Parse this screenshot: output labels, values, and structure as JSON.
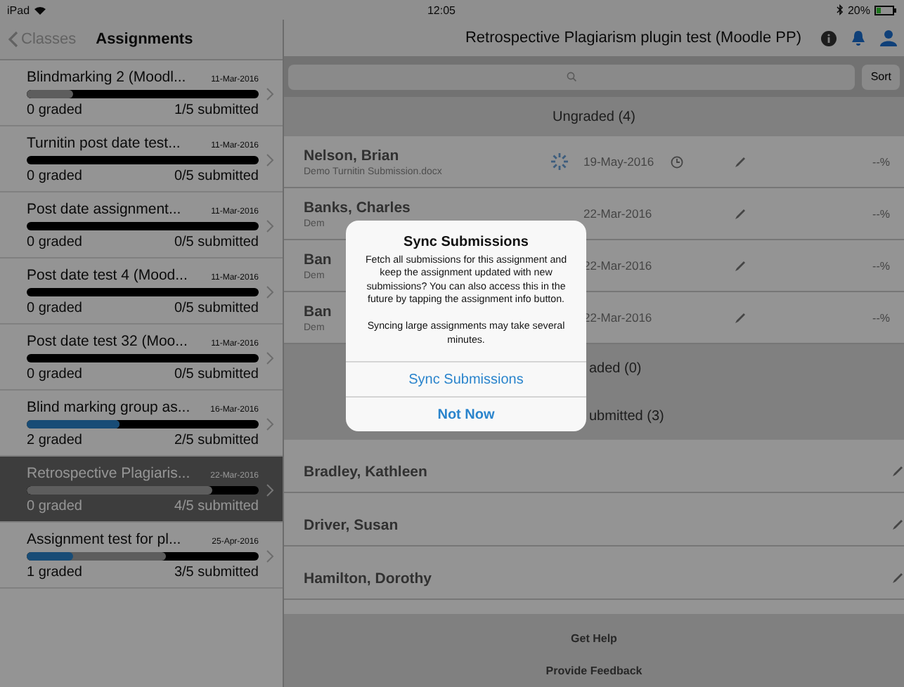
{
  "status_bar": {
    "device": "iPad",
    "time": "12:05",
    "battery": "20%"
  },
  "sidebar": {
    "back": "Classes",
    "title": "Assignments",
    "items": [
      {
        "title": "Blindmarking 2 (Moodl...",
        "date": "11-Mar-2016",
        "graded_bar": {
          "level": 0
        },
        "submitted_bar": {
          "level": 0.2
        },
        "graded": "0 graded",
        "submitted": "1/5 submitted",
        "selected": false
      },
      {
        "title": "Turnitin post date test...",
        "date": "11-Mar-2016",
        "graded_bar": {
          "level": 0
        },
        "submitted_bar": {
          "level": 0
        },
        "graded": "0 graded",
        "submitted": "0/5 submitted",
        "selected": false
      },
      {
        "title": "Post date assignment...",
        "date": "11-Mar-2016",
        "graded_bar": {
          "level": 0
        },
        "submitted_bar": {
          "level": 0
        },
        "graded": "0 graded",
        "submitted": "0/5 submitted",
        "selected": false
      },
      {
        "title": "Post date test 4 (Mood...",
        "date": "11-Mar-2016",
        "graded_bar": {
          "level": 0
        },
        "submitted_bar": {
          "level": 0
        },
        "graded": "0 graded",
        "submitted": "0/5 submitted",
        "selected": false
      },
      {
        "title": "Post date test 32 (Moo...",
        "date": "11-Mar-2016",
        "graded_bar": {
          "level": 0
        },
        "submitted_bar": {
          "level": 0
        },
        "graded": "0 graded",
        "submitted": "0/5 submitted",
        "selected": false
      },
      {
        "title": "Blind marking group as...",
        "date": "16-Mar-2016",
        "graded_bar": {
          "level": 0.4
        },
        "submitted_bar": {
          "level": 0.4
        },
        "graded": "2 graded",
        "submitted": "2/5 submitted",
        "selected": false
      },
      {
        "title": "Retrospective Plagiaris...",
        "date": "22-Mar-2016",
        "graded_bar": {
          "level": 0
        },
        "submitted_bar": {
          "level": 0.8
        },
        "graded": "0 graded",
        "submitted": "4/5 submitted",
        "selected": true
      },
      {
        "title": "Assignment test for pl...",
        "date": "25-Apr-2016",
        "graded_bar": {
          "level": 0.2
        },
        "submitted_bar": {
          "level": 0.6
        },
        "graded": "1 graded",
        "submitted": "3/5 submitted",
        "selected": false
      }
    ]
  },
  "main": {
    "title": "Retrospective Plagiarism plugin test (Moodle PP)",
    "sort": "Sort",
    "sections": [
      {
        "header": "Ungraded (4)",
        "kind": "full",
        "rows": [
          {
            "name": "Nelson, Brian",
            "file": "Demo Turnitin Submission.docx",
            "syncing": true,
            "date": "19-May-2016",
            "late": true,
            "grade": "--%"
          },
          {
            "name": "Banks, Charles",
            "file": "Dem",
            "syncing": false,
            "date": "22-Mar-2016",
            "late": false,
            "grade": "--%"
          },
          {
            "name": "Ban",
            "file": "Dem",
            "syncing": false,
            "date": "22-Mar-2016",
            "late": false,
            "grade": "--%"
          },
          {
            "name": "Ban",
            "file": "Dem",
            "syncing": false,
            "date": "22-Mar-2016",
            "late": false,
            "grade": "--%"
          }
        ]
      },
      {
        "header": "aded (0)",
        "kind": "covered"
      },
      {
        "header": "ubmitted (3)",
        "kind": "covered",
        "rows": [
          {
            "name": "Bradley, Kathleen"
          },
          {
            "name": "Driver, Susan"
          },
          {
            "name": "Hamilton, Dorothy"
          }
        ]
      }
    ],
    "footer": [
      "Get Help",
      "Provide Feedback"
    ]
  },
  "dialog": {
    "title": "Sync Submissions",
    "message": "Fetch all submissions for this assignment and keep the assignment updated with new submissions? You can also access this in the future by tapping the assignment info button.",
    "note": "Syncing large assignments may take several minutes.",
    "buttons": [
      {
        "label": "Sync Submissions",
        "bold": false
      },
      {
        "label": "Not Now",
        "bold": true
      }
    ]
  }
}
